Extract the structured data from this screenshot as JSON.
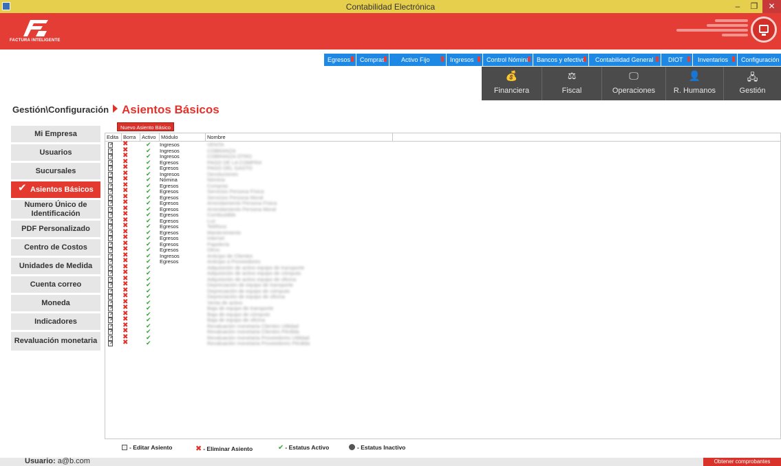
{
  "window": {
    "title": "Contabilidad Electrónica",
    "min": "–",
    "max": "❐",
    "close": "✕"
  },
  "brand": {
    "logo_text": "FACTURA INTELIGENTE"
  },
  "menu": [
    {
      "label": "Egresos",
      "pin": true
    },
    {
      "label": "Compras",
      "pin": true
    },
    {
      "label": "Activo Fijo",
      "pin": true
    },
    {
      "label": "Ingresos",
      "pin": true
    },
    {
      "label": "Control Nómina",
      "pin": true
    },
    {
      "label": "Bancos y efectivo",
      "pin": true
    },
    {
      "label": "Contabilidad General",
      "pin": true
    },
    {
      "label": "DIOT",
      "pin": true
    },
    {
      "label": "Inventarios",
      "pin": true
    },
    {
      "label": "Configuración",
      "pin": false
    }
  ],
  "bigtabs": [
    {
      "label": "Financiera",
      "icon": "coins-icon",
      "glyph": "💰"
    },
    {
      "label": "Fiscal",
      "icon": "scale-icon",
      "glyph": "⚖"
    },
    {
      "label": "Operaciones",
      "icon": "monitor-icon",
      "glyph": "🖵"
    },
    {
      "label": "R. Humanos",
      "icon": "person-icon",
      "glyph": "👤"
    },
    {
      "label": "Gestión",
      "icon": "org-chart-icon",
      "glyph": "🖧"
    }
  ],
  "breadcrumb": "Gestión\\Configuración",
  "page_title": "Asientos Básicos",
  "sidebar": [
    {
      "label": "Mi Empresa"
    },
    {
      "label": "Usuarios"
    },
    {
      "label": "Sucursales"
    },
    {
      "label": "Asientos Básicos",
      "active": true
    },
    {
      "label": "Numero Único de Identificación",
      "tall": true
    },
    {
      "label": "PDF Personalizado"
    },
    {
      "label": "Centro de Costos"
    },
    {
      "label": "Unidades de Medida"
    },
    {
      "label": "Cuenta correo"
    },
    {
      "label": "Moneda"
    },
    {
      "label": "Indicadores"
    },
    {
      "label": "Revaluación monetaria",
      "tall": true
    }
  ],
  "new_button": "Nuevo Asiento Básico",
  "grid": {
    "columns": [
      "Edita",
      "Borra",
      "Activo",
      "Módulo",
      "Nombre"
    ],
    "rows": [
      {
        "modulo": "Ingresos",
        "nombre": "VENTA"
      },
      {
        "modulo": "Ingresos",
        "nombre": "COBRANZA"
      },
      {
        "modulo": "Ingresos",
        "nombre": "COBRANZA OTRO"
      },
      {
        "modulo": "Egresos",
        "nombre": "PAGO DE LA COMPRA"
      },
      {
        "modulo": "Egresos",
        "nombre": "PAGO DEL GASTO"
      },
      {
        "modulo": "Ingresos",
        "nombre": "Devoluciones"
      },
      {
        "modulo": "Nómina",
        "nombre": "Nómina"
      },
      {
        "modulo": "Egresos",
        "nombre": "Compras"
      },
      {
        "modulo": "Egresos",
        "nombre": "Servicios Persona Física"
      },
      {
        "modulo": "Egresos",
        "nombre": "Servicios Persona Moral"
      },
      {
        "modulo": "Egresos",
        "nombre": "Arrendamiento Persona Física"
      },
      {
        "modulo": "Egresos",
        "nombre": "Arrendamiento Persona Moral"
      },
      {
        "modulo": "Egresos",
        "nombre": "Combustible"
      },
      {
        "modulo": "Egresos",
        "nombre": "Luz"
      },
      {
        "modulo": "Egresos",
        "nombre": "Teléfono"
      },
      {
        "modulo": "Egresos",
        "nombre": "Mantenimiento"
      },
      {
        "modulo": "Egresos",
        "nombre": "Internet"
      },
      {
        "modulo": "Egresos",
        "nombre": "Papelería"
      },
      {
        "modulo": "Egresos",
        "nombre": "Otros"
      },
      {
        "modulo": "Ingresos",
        "nombre": "Anticipo de Clientes"
      },
      {
        "modulo": "Egresos",
        "nombre": "Anticipo a Proveedores"
      },
      {
        "modulo": "",
        "nombre": "Adquisición de activo equipo de transporte"
      },
      {
        "modulo": "",
        "nombre": "Adquisición de activo equipo de cómputo"
      },
      {
        "modulo": "",
        "nombre": "Adquisición de activo equipo de oficina"
      },
      {
        "modulo": "",
        "nombre": "Depreciación de equipo de transporte"
      },
      {
        "modulo": "",
        "nombre": "Depreciación de equipo de cómputo"
      },
      {
        "modulo": "",
        "nombre": "Depreciación de equipo de oficina"
      },
      {
        "modulo": "",
        "nombre": "Venta de activo"
      },
      {
        "modulo": "",
        "nombre": "Baja de equipo de transporte"
      },
      {
        "modulo": "",
        "nombre": "Baja de equipo de cómputo"
      },
      {
        "modulo": "",
        "nombre": "Baja de equipo de oficina"
      },
      {
        "modulo": "",
        "nombre": "Revaluación monetaria Clientes Utilidad"
      },
      {
        "modulo": "",
        "nombre": "Revaluación monetaria Clientes Pérdida"
      },
      {
        "modulo": "",
        "nombre": "Revaluación monetaria Proveedores Utilidad"
      },
      {
        "modulo": "",
        "nombre": "Revaluación monetaria Proveedores Pérdida"
      }
    ]
  },
  "legend": {
    "edit": "- Editar Asiento",
    "delete": "- Eliminar Asiento",
    "active": "- Estatus Activo",
    "inactive": "- Estatus Inactivo"
  },
  "footer": {
    "user_label": "Usuario:",
    "user_value": "a@b.com",
    "get_button": "Obtener comprobantes"
  },
  "colors": {
    "red": "#e33d36",
    "menu_blue": "#1e88e5",
    "titlebar": "#e6cf4c",
    "tab_dark": "#4b4b4b"
  }
}
